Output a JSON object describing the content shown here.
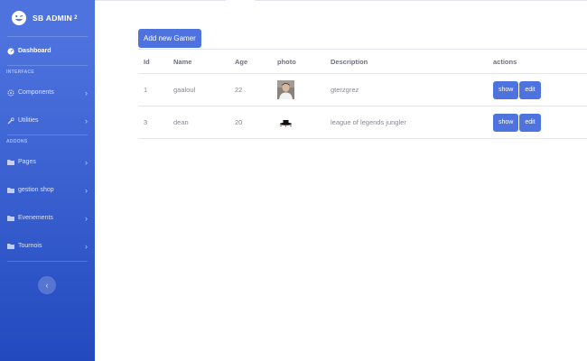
{
  "brand": {
    "name": "SB ADMIN",
    "superscript": "2"
  },
  "sidebar": {
    "dashboard": "Dashboard",
    "heading_interface": "INTERFACE",
    "heading_addons": "ADDONS",
    "items": [
      {
        "label": "Components",
        "icon": "gear-icon"
      },
      {
        "label": "Utilities",
        "icon": "wrench-icon"
      },
      {
        "label": "Pages",
        "icon": "folder-icon"
      },
      {
        "label": "gestion shop",
        "icon": "folder-icon"
      },
      {
        "label": "Evenements",
        "icon": "folder-icon"
      },
      {
        "label": "Tournois",
        "icon": "folder-icon"
      }
    ],
    "toggle_icon": "chevron-left-icon"
  },
  "main": {
    "add_button": "Add new Gamer",
    "table": {
      "headers": [
        "Id",
        "Name",
        "Age",
        "photo",
        "Description",
        "actions"
      ],
      "rows": [
        {
          "id": "1",
          "name": "gaaloul",
          "age": "22",
          "photo": "person-photo",
          "description": "gterzgrez",
          "show": "show",
          "edit": "edit"
        },
        {
          "id": "3",
          "name": "dean",
          "age": "20",
          "photo": "hat-photo",
          "description": "league of legends jungler",
          "show": "show",
          "edit": "edit"
        }
      ]
    }
  },
  "colors": {
    "primary": "#4e73df",
    "primary_dark": "#224abe",
    "text_muted": "#858796",
    "border": "#e3e6f0"
  }
}
